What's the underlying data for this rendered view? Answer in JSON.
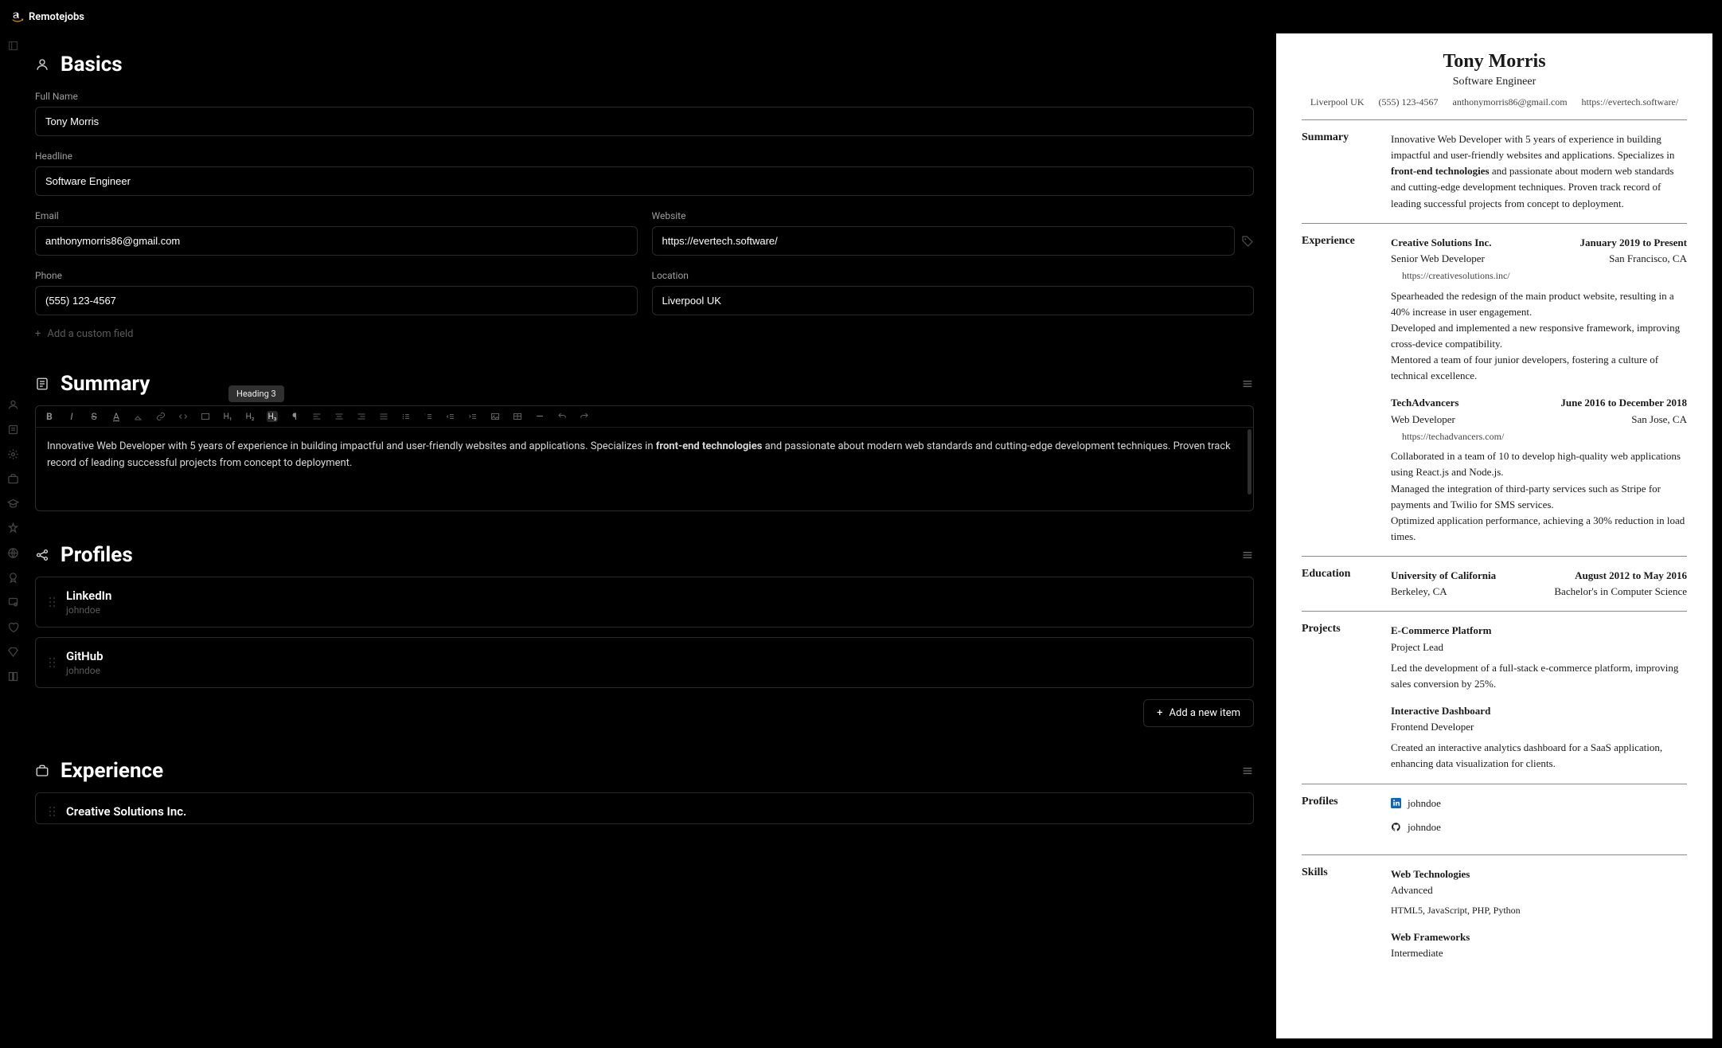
{
  "brand": {
    "name": "Remotejobs"
  },
  "sections": {
    "basics": {
      "title": "Basics",
      "fields": {
        "fullName": {
          "label": "Full Name",
          "value": "Tony Morris"
        },
        "headline": {
          "label": "Headline",
          "value": "Software Engineer"
        },
        "email": {
          "label": "Email",
          "value": "anthonymorris86@gmail.com"
        },
        "website": {
          "label": "Website",
          "value": "https://evertech.software/"
        },
        "phone": {
          "label": "Phone",
          "value": "(555) 123-4567"
        },
        "location": {
          "label": "Location",
          "value": "Liverpool UK"
        }
      },
      "addCustomLabel": "Add a custom field"
    },
    "summary": {
      "title": "Summary",
      "tooltip": "Heading 3",
      "body_pre": "Innovative Web Developer with 5 years of experience in building impactful and user-friendly websites and applications. Specializes in ",
      "body_bold": "front-end technologies",
      "body_post": " and passionate about modern web standards and cutting-edge development techniques. Proven track record of leading successful projects from concept to deployment."
    },
    "profiles": {
      "title": "Profiles",
      "items": [
        {
          "network": "LinkedIn",
          "username": "johndoe"
        },
        {
          "network": "GitHub",
          "username": "johndoe"
        }
      ],
      "addLabel": "Add a new item"
    },
    "experience": {
      "title": "Experience",
      "items": [
        {
          "company": "Creative Solutions Inc."
        }
      ]
    }
  },
  "preview": {
    "name": "Tony Morris",
    "headline": "Software Engineer",
    "contact": {
      "location": "Liverpool UK",
      "phone": "(555) 123-4567",
      "email": "anthonymorris86@gmail.com",
      "website": "https://evertech.software/"
    },
    "labels": {
      "summary": "Summary",
      "experience": "Experience",
      "education": "Education",
      "projects": "Projects",
      "profiles": "Profiles",
      "skills": "Skills"
    },
    "summary_pre": "Innovative Web Developer with 5 years of experience in building impactful and user-friendly websites and applications. Specializes in ",
    "summary_bold": "front-end technologies",
    "summary_post": " and passionate about modern web standards and cutting-edge development techniques. Proven track record of leading successful projects from concept to deployment.",
    "experience": [
      {
        "company": "Creative Solutions Inc.",
        "range": "January 2019 to Present",
        "position": "Senior Web Developer",
        "location": "San Francisco, CA",
        "url": "https://creativesolutions.inc/",
        "bullets": [
          "Spearheaded the redesign of the main product website, resulting in a 40% increase in user engagement.",
          "Developed and implemented a new responsive framework, improving cross-device compatibility.",
          "Mentored a team of four junior developers, fostering a culture of technical excellence."
        ]
      },
      {
        "company": "TechAdvancers",
        "range": "June 2016 to December 2018",
        "position": "Web Developer",
        "location": "San Jose, CA",
        "url": "https://techadvancers.com/",
        "bullets": [
          "Collaborated in a team of 10 to develop high-quality web applications using React.js and Node.js.",
          "Managed the integration of third-party services such as Stripe for payments and Twilio for SMS services.",
          "Optimized application performance, achieving a 30% reduction in load times."
        ]
      }
    ],
    "education": [
      {
        "institution": "University of California",
        "range": "August 2012 to May 2016",
        "city": "Berkeley, CA",
        "degree": "Bachelor's in Computer Science"
      }
    ],
    "projects": [
      {
        "name": "E-Commerce Platform",
        "role": "Project Lead",
        "desc": "Led the development of a full-stack e-commerce platform, improving sales conversion by 25%."
      },
      {
        "name": "Interactive Dashboard",
        "role": "Frontend Developer",
        "desc": "Created an interactive analytics dashboard for a SaaS application, enhancing data visualization for clients."
      }
    ],
    "profiles": [
      {
        "icon": "linkedin",
        "username": "johndoe"
      },
      {
        "icon": "github",
        "username": "johndoe"
      }
    ],
    "skills": [
      {
        "name": "Web Technologies",
        "level": "Advanced",
        "keywords": "HTML5, JavaScript, PHP, Python"
      },
      {
        "name": "Web Frameworks",
        "level": "Intermediate",
        "keywords": ""
      }
    ]
  }
}
